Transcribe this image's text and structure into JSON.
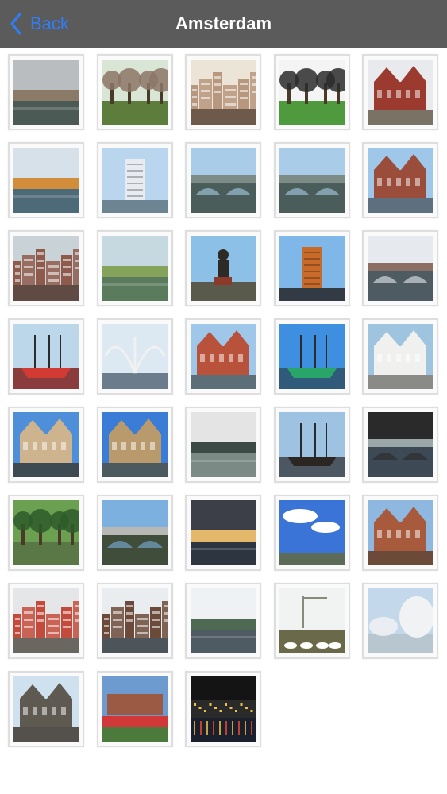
{
  "navbar": {
    "back_label": "Back",
    "title": "Amsterdam",
    "accent_color": "#2f7ef6",
    "bar_color": "#5b5b5b"
  },
  "gallery": {
    "columns": 5,
    "photos": [
      {
        "sky": "#b9bdbf",
        "ground": "#4b5a55",
        "accent": "#8a7a66",
        "kind": "canal"
      },
      {
        "sky": "#d9e6d6",
        "ground": "#5d7d3d",
        "accent": "#8c7566",
        "kind": "trees"
      },
      {
        "sky": "#ede4d8",
        "ground": "#6e5a4a",
        "accent": "#b7977d",
        "kind": "houses"
      },
      {
        "sky": "#f4f4f4",
        "ground": "#4e9a3d",
        "accent": "#2b2b2b",
        "kind": "park"
      },
      {
        "sky": "#e9eaee",
        "ground": "#7b7266",
        "accent": "#9b3a2f",
        "kind": "castle"
      },
      {
        "sky": "#d6e1ea",
        "ground": "#4d6a78",
        "accent": "#d28c3a",
        "kind": "canal"
      },
      {
        "sky": "#b9d6ee",
        "ground": "#6d8592",
        "accent": "#e8ecf0",
        "kind": "tower"
      },
      {
        "sky": "#a9cde8",
        "ground": "#4b5d5a",
        "accent": "#7d8c86",
        "kind": "bridge"
      },
      {
        "sky": "#a9cde8",
        "ground": "#4b5d5a",
        "accent": "#7d8c86",
        "kind": "bridge"
      },
      {
        "sky": "#9fc7e9",
        "ground": "#5e6f7e",
        "accent": "#9b4d3b",
        "kind": "station"
      },
      {
        "sky": "#c9d2d6",
        "ground": "#5f4a44",
        "accent": "#8e5a4c",
        "kind": "houses"
      },
      {
        "sky": "#c7d9e0",
        "ground": "#5a7b5c",
        "accent": "#85a35a",
        "kind": "pond"
      },
      {
        "sky": "#8cc0e6",
        "ground": "#5a5a4c",
        "accent": "#2e2a26",
        "kind": "statue"
      },
      {
        "sky": "#7fb8e8",
        "ground": "#323a44",
        "accent": "#c86a2a",
        "kind": "tower"
      },
      {
        "sky": "#e6eaee",
        "ground": "#4f5b62",
        "accent": "#8a6f62",
        "kind": "bridge"
      },
      {
        "sky": "#bcd6ea",
        "ground": "#8a3c3c",
        "accent": "#d23b34",
        "kind": "ship"
      },
      {
        "sky": "#dce9f2",
        "ground": "#6b7d8c",
        "accent": "#f1f1f1",
        "kind": "fountain"
      },
      {
        "sky": "#9ec7ea",
        "ground": "#5c6e78",
        "accent": "#b9523a",
        "kind": "castle"
      },
      {
        "sky": "#3e8fe0",
        "ground": "#2f5a7a",
        "accent": "#2aa56a",
        "kind": "ship"
      },
      {
        "sky": "#9fc4e0",
        "ground": "#8a8a86",
        "accent": "#f0f0ee",
        "kind": "station"
      },
      {
        "sky": "#4f8fd9",
        "ground": "#3d4a52",
        "accent": "#cdb48e",
        "kind": "castle"
      },
      {
        "sky": "#3a7cd6",
        "ground": "#4c5a60",
        "accent": "#b89a6c",
        "kind": "castle"
      },
      {
        "sky": "#e4e4e4",
        "ground": "#7c8a86",
        "accent": "#3b4a44",
        "kind": "canal"
      },
      {
        "sky": "#9ec3e2",
        "ground": "#4c5762",
        "accent": "#2b2622",
        "kind": "ship"
      },
      {
        "sky": "#2a2a2a",
        "ground": "#3d4a55",
        "accent": "#9aa7a9",
        "kind": "bridge"
      },
      {
        "sky": "#6aa050",
        "ground": "#5a7846",
        "accent": "#2e5b2a",
        "kind": "trees"
      },
      {
        "sky": "#7cb0de",
        "ground": "#3f4d3a",
        "accent": "#b8b8b4",
        "kind": "bridge"
      },
      {
        "sky": "#3c3f48",
        "ground": "#2c3540",
        "accent": "#e3b86a",
        "kind": "canal"
      },
      {
        "sky": "#3a74d6",
        "ground": "#5b6b58",
        "accent": "#ffffff",
        "kind": "clouds"
      },
      {
        "sky": "#8fb8e0",
        "ground": "#6b4a3a",
        "accent": "#a85a3c",
        "kind": "station"
      },
      {
        "sky": "#e4e6e8",
        "ground": "#6a6660",
        "accent": "#c34b3c",
        "kind": "houses"
      },
      {
        "sky": "#e9edf0",
        "ground": "#4e555a",
        "accent": "#6c4a3a",
        "kind": "houses"
      },
      {
        "sky": "#eef2f4",
        "ground": "#4f5b62",
        "accent": "#4f6a52",
        "kind": "canal"
      },
      {
        "sky": "#f1f2f2",
        "ground": "#6a6a4a",
        "accent": "#ffffff",
        "kind": "geese"
      },
      {
        "sky": "#c3d8ea",
        "ground": "#b8c6d0",
        "accent": "#f1f2f4",
        "kind": "winter"
      },
      {
        "sky": "#cfe0ee",
        "ground": "#54514c",
        "accent": "#5e5a52",
        "kind": "castle"
      },
      {
        "sky": "#6d9bd0",
        "ground": "#4c7a3c",
        "accent": "#d2383a",
        "kind": "sign"
      },
      {
        "sky": "#141414",
        "ground": "#1a1f2c",
        "accent": "#f0c24a",
        "kind": "night"
      }
    ]
  }
}
